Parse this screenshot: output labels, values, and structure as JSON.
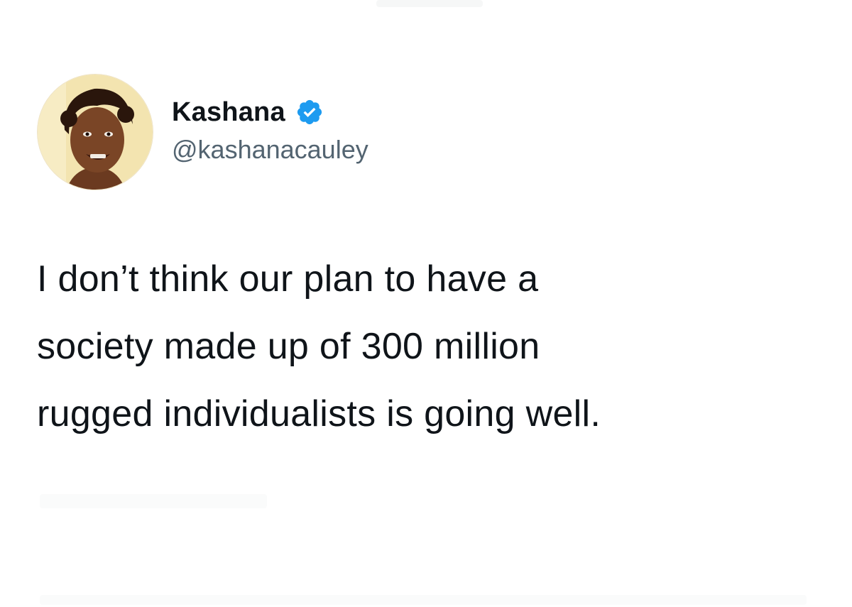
{
  "tweet": {
    "author": {
      "display_name": "Kashana",
      "handle": "@kashanacauley",
      "verified": true,
      "avatar_icon": "profile-photo",
      "badge_icon": "verified-check-icon",
      "badge_color": "#1d9bf0"
    },
    "text_lines": [
      "I don’t think our plan to have a",
      "society made up of 300 million",
      "rugged individualists is going well."
    ]
  }
}
